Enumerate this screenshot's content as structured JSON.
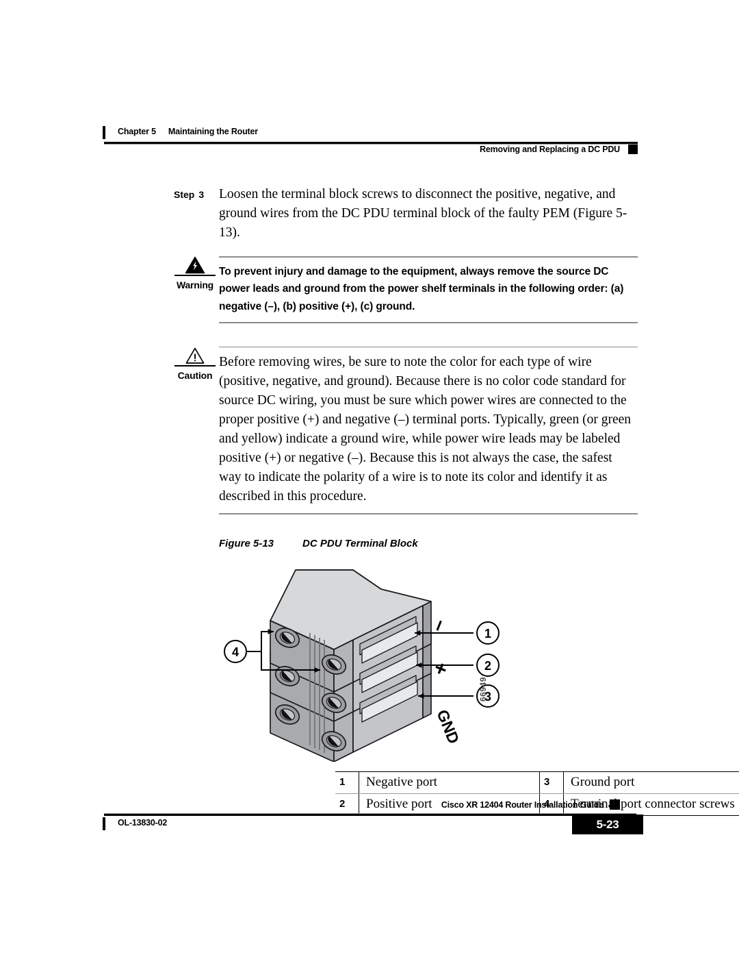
{
  "header": {
    "chapter_label": "Chapter",
    "chapter_number": "5",
    "chapter_title": "Maintaining the Router",
    "section_title": "Removing and Replacing a DC PDU"
  },
  "step": {
    "label": "Step",
    "number": "3",
    "text": "Loosen the terminal block screws to disconnect the positive, negative, and ground wires from the DC PDU terminal block of the faulty PEM (Figure 5-13)."
  },
  "warning": {
    "icon": "warning-lightning-triangle-icon",
    "label": "Warning",
    "text": "To prevent injury and damage to the equipment, always remove the source DC power leads and ground from the power shelf terminals in the following order: (a) negative (–), (b) positive (+), (c) ground."
  },
  "caution": {
    "icon": "caution-exclamation-triangle-icon",
    "label": "Caution",
    "text": "Before removing wires, be sure to note the color for each type of wire (positive, negative, and ground). Because there is no color code standard for source DC wiring, you must be sure which power wires are connected to the proper positive (+) and negative (–) terminal ports. Typically, green (or green and yellow) indicate a ground wire, while power wire leads may be labeled positive (+) or negative (–). Because this is not always the case, the safest way to indicate the polarity of a wire is to note its color and identify it as described in this procedure."
  },
  "figure": {
    "label": "Figure 5-13",
    "title": "DC PDU Terminal Block",
    "art_id": "66949",
    "port_labels": {
      "negative": "–",
      "positive": "+",
      "ground": "GND"
    },
    "callout_numbers": [
      "1",
      "2",
      "3",
      "4"
    ],
    "colors": {
      "top_face": "#d6d8da",
      "left_face": "#a8aaae",
      "front_face": "#c3c5c8",
      "slot_light": "#e8e9ea",
      "slot_mid": "#b9bbbe",
      "outline": "#1a1a1a"
    }
  },
  "callout_table": {
    "rows": [
      {
        "left_num": "1",
        "left_text": "Negative port",
        "right_num": "3",
        "right_text": "Ground port"
      },
      {
        "left_num": "2",
        "left_text": "Positive port",
        "right_num": "4",
        "right_text": "Terminal port connector screws"
      }
    ]
  },
  "footer": {
    "guide_title": "Cisco XR 12404 Router Installation Guide",
    "doc_id": "OL-13830-02",
    "page_number": "5-23"
  }
}
